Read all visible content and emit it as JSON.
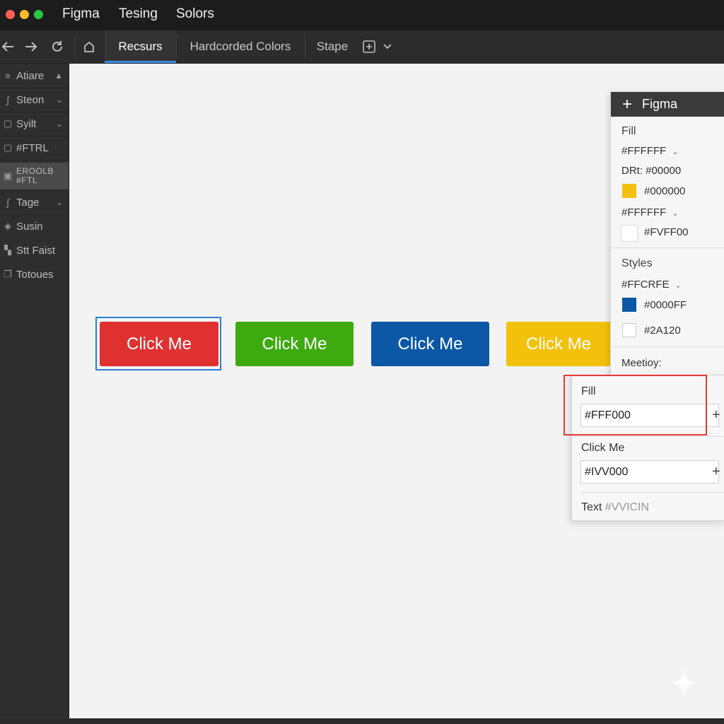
{
  "window": {
    "menu": [
      "Figma",
      "Tesing",
      "Solors"
    ],
    "traffic_colors": [
      "#fe5f57",
      "#febc2e",
      "#28c840"
    ]
  },
  "toolbar": {
    "tabs": [
      "Recsurs",
      "Hardcorded Colors",
      "Stape"
    ]
  },
  "sidebar": {
    "items": [
      {
        "label": "Atiare",
        "icon": "layers-icon",
        "chevron": "▲"
      },
      {
        "label": "Steon",
        "icon": "pen-icon",
        "chevron": "⌄"
      },
      {
        "label": "Syilt",
        "icon": "frame-icon",
        "chevron": "⌄"
      },
      {
        "label": "#FTRL",
        "icon": "frame-icon",
        "chevron": ""
      },
      {
        "label": "EROOLB",
        "label2": "#FTL",
        "icon": "grid-icon",
        "chevron": ""
      },
      {
        "label": "Tage",
        "icon": "pen-icon",
        "chevron": "⌄"
      },
      {
        "label": "Susin",
        "icon": "component-icon",
        "chevron": ""
      },
      {
        "label": "Stt Faist",
        "icon": "grid-icon",
        "chevron": ""
      },
      {
        "label": "Totoues",
        "icon": "pages-icon",
        "chevron": ""
      }
    ]
  },
  "canvas": {
    "buttons": [
      {
        "label": "Click Me",
        "color": "#e03131"
      },
      {
        "label": "Click Me",
        "color": "#3eaa0f"
      },
      {
        "label": "Click Me",
        "color": "#0b57a6"
      },
      {
        "label": "Click Me",
        "color": "#f3c10b"
      }
    ]
  },
  "panel": {
    "title": "Figma",
    "fill_header": "Fill",
    "fill_value": "#FFFFFF",
    "dri_label": "DRt:",
    "dri_value": "#00000",
    "swatch1_value": "#000000",
    "swatch1_color": "#f3c10b",
    "fill2_value": "#FFFFFF",
    "swatch2_value": "#FVFF00",
    "swatch2_color": "#ffffff",
    "styles_header": "Styles",
    "style_value": "#FFCRFE",
    "swatch3_value": "#0000FF",
    "swatch3_color": "#0b57a6",
    "swatch4_value": "#2A120",
    "swatch4_color": "#ffffff",
    "memory_label": "Meetioy:"
  },
  "popup": {
    "fill_label": "Fill",
    "fill_input": "#FFF000",
    "click_label": "Click Me",
    "click_input": "#IVV000",
    "text_label": "Text",
    "text_value": "#VVICIN"
  }
}
